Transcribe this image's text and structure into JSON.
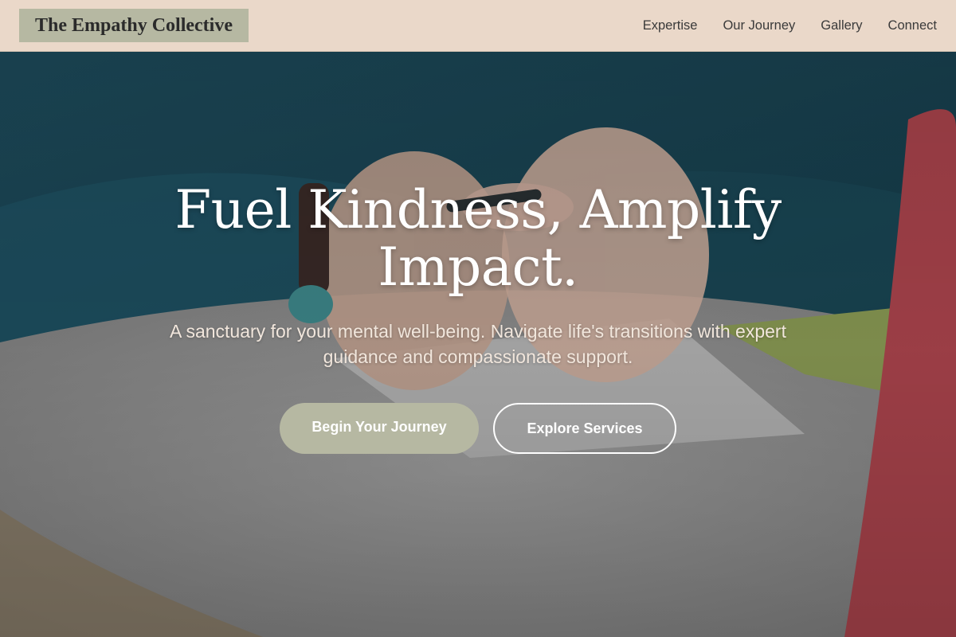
{
  "header": {
    "logo": "The Empathy Collective",
    "nav": [
      "Expertise",
      "Our Journey",
      "Gallery",
      "Connect"
    ]
  },
  "hero": {
    "title": "Fuel Kindness, Amplify Impact.",
    "subtitle": "A sanctuary for your mental well-being. Navigate life's transitions with expert guidance and compassionate support.",
    "primary_button": "Begin Your Journey",
    "secondary_button": "Explore Services",
    "background_image": "hands-holding-pen-at-table"
  },
  "colors": {
    "header_bg": "#ead8c9",
    "logo_bg": "#b6b8a2",
    "accent": "#b6b8a2",
    "text_light": "#ffffff"
  }
}
